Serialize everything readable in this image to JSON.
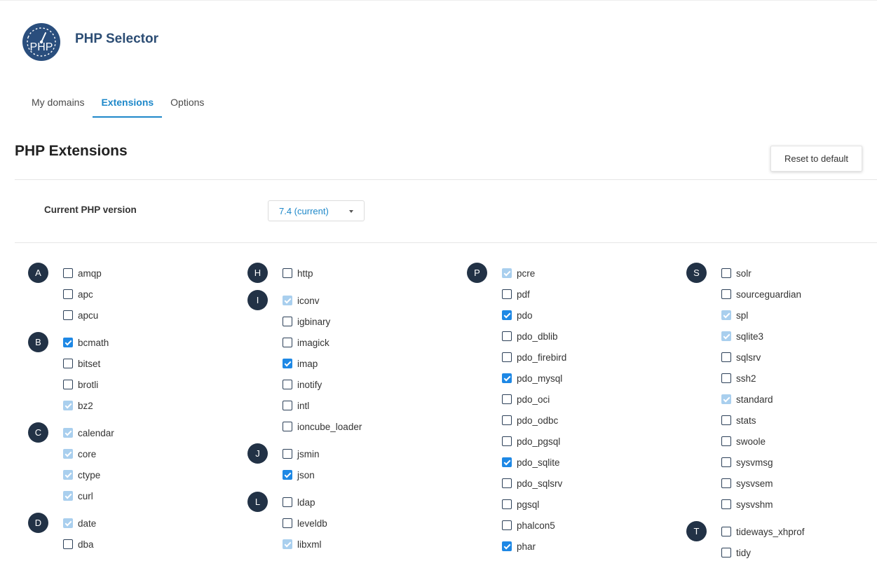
{
  "app": {
    "title": "PHP Selector",
    "logo_text": "PHP"
  },
  "tabs": [
    {
      "label": "My domains",
      "active": false
    },
    {
      "label": "Extensions",
      "active": true
    },
    {
      "label": "Options",
      "active": false
    }
  ],
  "page": {
    "title": "PHP Extensions",
    "reset_label": "Reset to default"
  },
  "version": {
    "label": "Current PHP version",
    "value": "7.4 (current)"
  },
  "colors": {
    "accent": "#1e88c9",
    "checked": "#1e88e5",
    "checked_disabled": "#a9cfee",
    "letter_badge": "#223246",
    "logo": "#2a4e7d"
  },
  "columns": [
    {
      "groups": [
        {
          "letter": "A",
          "items": [
            {
              "name": "amqp",
              "state": "unchecked"
            },
            {
              "name": "apc",
              "state": "unchecked"
            },
            {
              "name": "apcu",
              "state": "unchecked"
            }
          ]
        },
        {
          "letter": "B",
          "items": [
            {
              "name": "bcmath",
              "state": "checked"
            },
            {
              "name": "bitset",
              "state": "unchecked"
            },
            {
              "name": "brotli",
              "state": "unchecked"
            },
            {
              "name": "bz2",
              "state": "disabled"
            }
          ]
        },
        {
          "letter": "C",
          "items": [
            {
              "name": "calendar",
              "state": "disabled"
            },
            {
              "name": "core",
              "state": "disabled"
            },
            {
              "name": "ctype",
              "state": "disabled"
            },
            {
              "name": "curl",
              "state": "disabled"
            }
          ]
        },
        {
          "letter": "D",
          "items": [
            {
              "name": "date",
              "state": "disabled"
            },
            {
              "name": "dba",
              "state": "unchecked"
            }
          ]
        }
      ]
    },
    {
      "groups": [
        {
          "letter": "H",
          "items": [
            {
              "name": "http",
              "state": "unchecked"
            }
          ]
        },
        {
          "letter": "I",
          "items": [
            {
              "name": "iconv",
              "state": "disabled"
            },
            {
              "name": "igbinary",
              "state": "unchecked"
            },
            {
              "name": "imagick",
              "state": "unchecked"
            },
            {
              "name": "imap",
              "state": "checked"
            },
            {
              "name": "inotify",
              "state": "unchecked"
            },
            {
              "name": "intl",
              "state": "unchecked"
            },
            {
              "name": "ioncube_loader",
              "state": "unchecked"
            }
          ]
        },
        {
          "letter": "J",
          "items": [
            {
              "name": "jsmin",
              "state": "unchecked"
            },
            {
              "name": "json",
              "state": "checked"
            }
          ]
        },
        {
          "letter": "L",
          "items": [
            {
              "name": "ldap",
              "state": "unchecked"
            },
            {
              "name": "leveldb",
              "state": "unchecked"
            },
            {
              "name": "libxml",
              "state": "disabled"
            }
          ]
        }
      ]
    },
    {
      "groups": [
        {
          "letter": "P",
          "items": [
            {
              "name": "pcre",
              "state": "disabled"
            },
            {
              "name": "pdf",
              "state": "unchecked"
            },
            {
              "name": "pdo",
              "state": "checked"
            },
            {
              "name": "pdo_dblib",
              "state": "unchecked"
            },
            {
              "name": "pdo_firebird",
              "state": "unchecked"
            },
            {
              "name": "pdo_mysql",
              "state": "checked"
            },
            {
              "name": "pdo_oci",
              "state": "unchecked"
            },
            {
              "name": "pdo_odbc",
              "state": "unchecked"
            },
            {
              "name": "pdo_pgsql",
              "state": "unchecked"
            },
            {
              "name": "pdo_sqlite",
              "state": "checked"
            },
            {
              "name": "pdo_sqlsrv",
              "state": "unchecked"
            },
            {
              "name": "pgsql",
              "state": "unchecked"
            },
            {
              "name": "phalcon5",
              "state": "unchecked"
            },
            {
              "name": "phar",
              "state": "checked"
            }
          ]
        }
      ]
    },
    {
      "groups": [
        {
          "letter": "S",
          "items": [
            {
              "name": "solr",
              "state": "unchecked"
            },
            {
              "name": "sourceguardian",
              "state": "unchecked"
            },
            {
              "name": "spl",
              "state": "disabled"
            },
            {
              "name": "sqlite3",
              "state": "disabled"
            },
            {
              "name": "sqlsrv",
              "state": "unchecked"
            },
            {
              "name": "ssh2",
              "state": "unchecked"
            },
            {
              "name": "standard",
              "state": "disabled"
            },
            {
              "name": "stats",
              "state": "unchecked"
            },
            {
              "name": "swoole",
              "state": "unchecked"
            },
            {
              "name": "sysvmsg",
              "state": "unchecked"
            },
            {
              "name": "sysvsem",
              "state": "unchecked"
            },
            {
              "name": "sysvshm",
              "state": "unchecked"
            }
          ]
        },
        {
          "letter": "T",
          "items": [
            {
              "name": "tideways_xhprof",
              "state": "unchecked"
            },
            {
              "name": "tidy",
              "state": "unchecked"
            }
          ]
        }
      ]
    }
  ]
}
